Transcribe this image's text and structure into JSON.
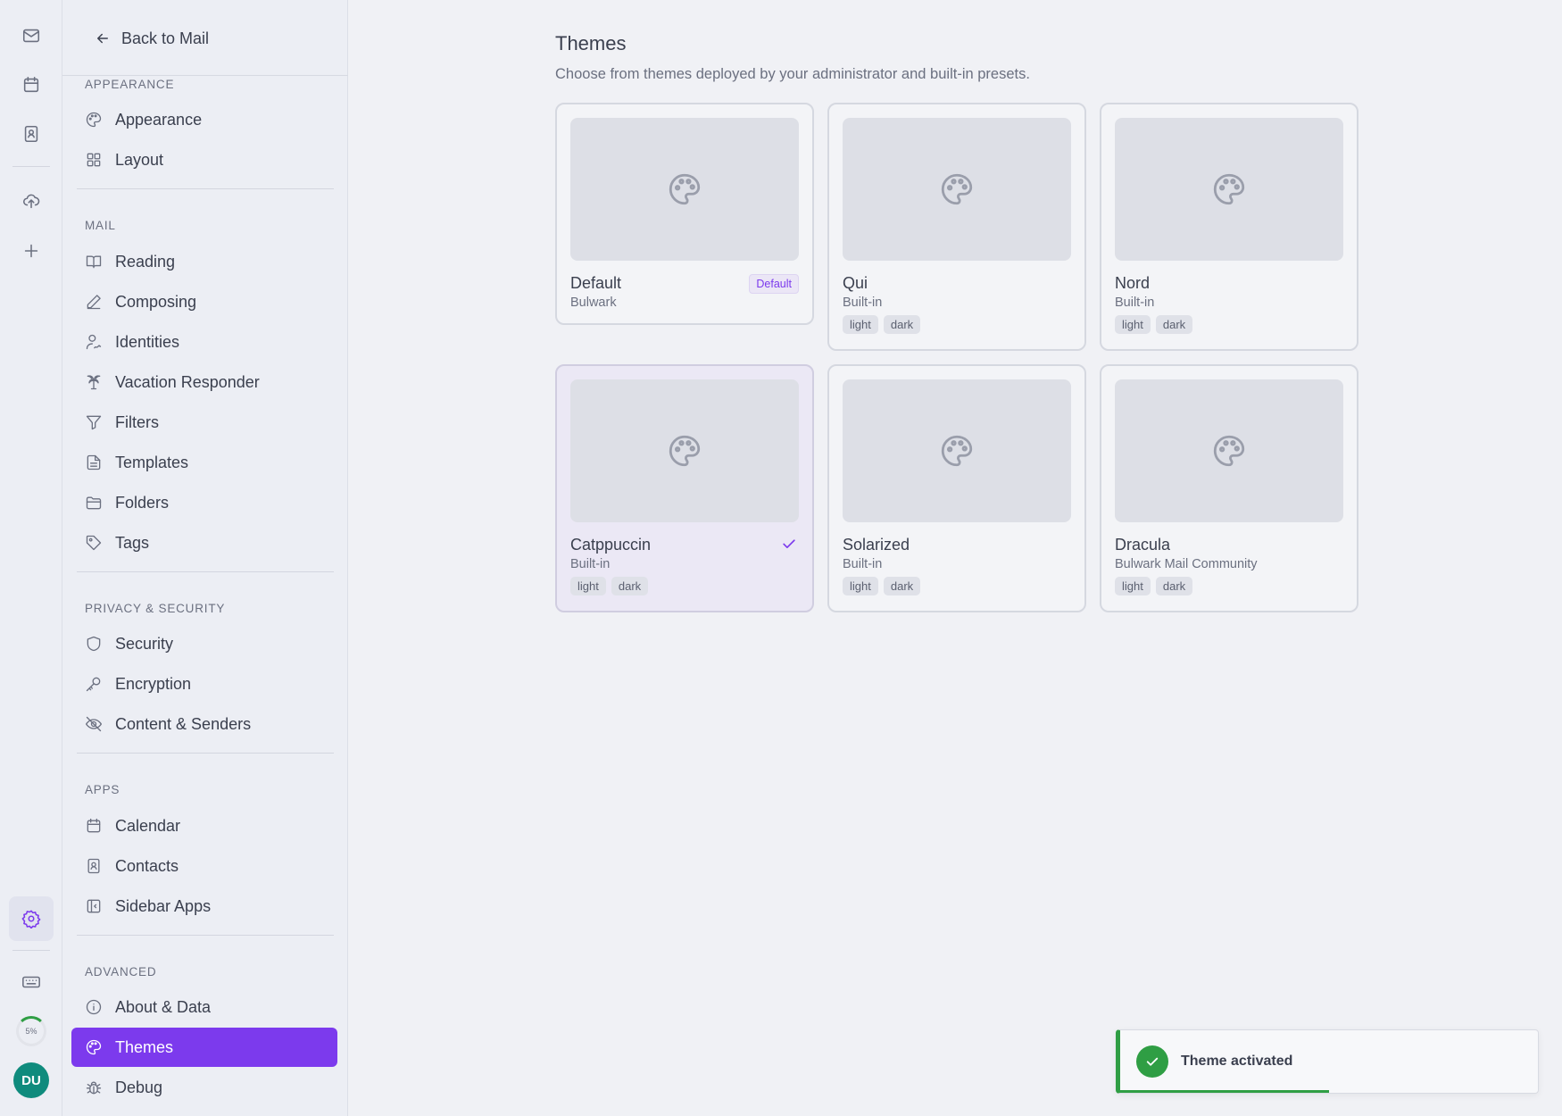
{
  "rail": {
    "icons": [
      "mail-icon",
      "calendar-icon",
      "contacts-icon",
      "cloud-upload-icon",
      "plus-icon",
      "settings-icon",
      "keyboard-icon"
    ],
    "quota_label": "5%",
    "avatar_initials": "DU"
  },
  "sidebar": {
    "back_label": "Back to Mail",
    "sections": [
      {
        "title": "APPEARANCE",
        "items": [
          {
            "label": "Appearance",
            "icon": "palette-icon"
          },
          {
            "label": "Layout",
            "icon": "grid-icon"
          }
        ]
      },
      {
        "title": "MAIL",
        "items": [
          {
            "label": "Reading",
            "icon": "book-icon"
          },
          {
            "label": "Composing",
            "icon": "pen-icon"
          },
          {
            "label": "Identities",
            "icon": "user-signature-icon"
          },
          {
            "label": "Vacation Responder",
            "icon": "palm-tree-icon"
          },
          {
            "label": "Filters",
            "icon": "filter-icon"
          },
          {
            "label": "Templates",
            "icon": "document-icon"
          },
          {
            "label": "Folders",
            "icon": "folder-icon"
          },
          {
            "label": "Tags",
            "icon": "tag-icon"
          }
        ]
      },
      {
        "title": "PRIVACY & SECURITY",
        "items": [
          {
            "label": "Security",
            "icon": "shield-icon"
          },
          {
            "label": "Encryption",
            "icon": "key-icon"
          },
          {
            "label": "Content & Senders",
            "icon": "eye-off-icon"
          }
        ]
      },
      {
        "title": "APPS",
        "items": [
          {
            "label": "Calendar",
            "icon": "calendar-icon"
          },
          {
            "label": "Contacts",
            "icon": "contacts-icon"
          },
          {
            "label": "Sidebar Apps",
            "icon": "sidebar-icon"
          }
        ]
      },
      {
        "title": "ADVANCED",
        "items": [
          {
            "label": "About & Data",
            "icon": "info-icon"
          },
          {
            "label": "Themes",
            "icon": "palette-icon",
            "active": true
          },
          {
            "label": "Debug",
            "icon": "bug-icon"
          }
        ]
      }
    ]
  },
  "main": {
    "title": "Themes",
    "subtitle": "Choose from themes deployed by your administrator and built-in presets.",
    "themes": [
      {
        "name": "Default",
        "author": "Bulwark",
        "badge": "Default",
        "tags": []
      },
      {
        "name": "Qui",
        "author": "Built-in",
        "tags": [
          "light",
          "dark"
        ]
      },
      {
        "name": "Nord",
        "author": "Built-in",
        "tags": [
          "light",
          "dark"
        ]
      },
      {
        "name": "Catppuccin",
        "author": "Built-in",
        "tags": [
          "light",
          "dark"
        ],
        "selected": true
      },
      {
        "name": "Solarized",
        "author": "Built-in",
        "tags": [
          "light",
          "dark"
        ]
      },
      {
        "name": "Dracula",
        "author": "Bulwark Mail Community",
        "tags": [
          "light",
          "dark"
        ]
      }
    ]
  },
  "toast": {
    "message": "Theme activated",
    "status_color": "#2f9e44",
    "progress": 0.5
  },
  "colors": {
    "accent": "#7c3aed",
    "success": "#2f9e44",
    "avatar": "#0f8b7d"
  }
}
